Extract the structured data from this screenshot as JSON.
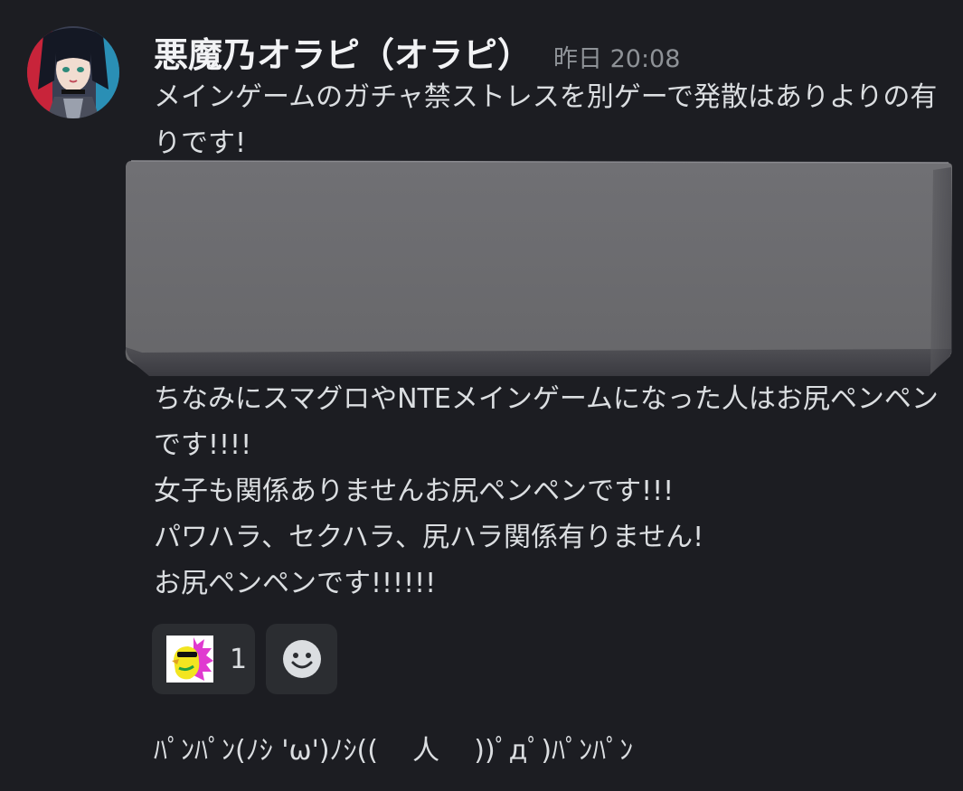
{
  "message": {
    "author": {
      "name": "悪魔乃オラピ（オラピ）",
      "avatar_icon": "anime-girl-avatar-icon"
    },
    "timestamp": "昨日 20:08",
    "text_before": "メインゲームのガチャ禁ストレスを別ゲーで発散はありよりの有りです!",
    "attachment": {
      "icon": "gray-box-image-icon"
    },
    "text_after": "ちなみにスマグロやNTEメインゲームになった人はお尻ペンペンです!!!!\n女子も関係ありませんお尻ペンペンです!!!\nパワハラ、セクハラ、尻ハラ関係有りません!\nお尻ペンペンです!!!!!!",
    "reactions": [
      {
        "emoji_icon": "yellow-bird-sticker-icon",
        "count": "1"
      },
      {
        "emoji_icon": "add-reaction-smiley-icon"
      }
    ]
  },
  "next_message": {
    "text": "ﾊﾟﾝﾊﾟﾝ(ﾉｼ 'ω')ﾉｼ((    人    ))ﾟдﾟ)ﾊﾟﾝﾊﾟﾝ"
  },
  "colors": {
    "background": "#1c1d22",
    "text": "#dbdee1",
    "username": "#f2f3f5",
    "timestamp": "#8e9297",
    "reaction_bg": "#2b2d31"
  }
}
